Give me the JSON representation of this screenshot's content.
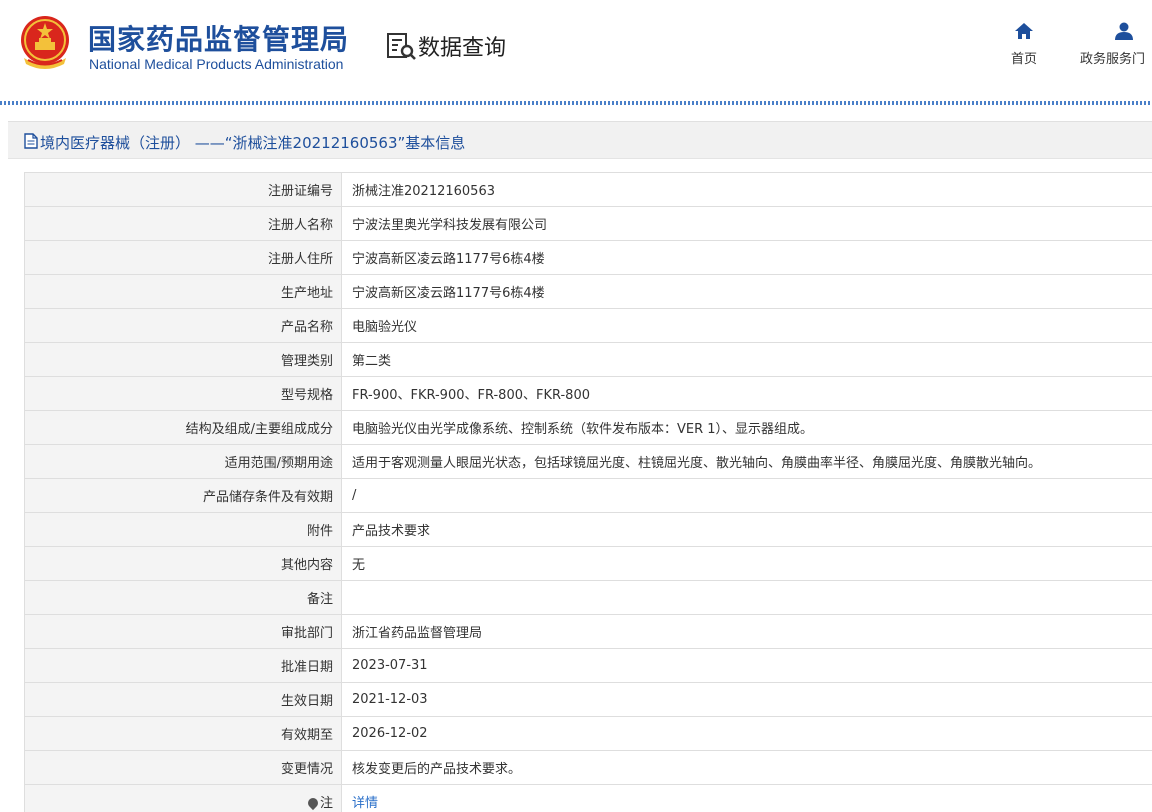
{
  "header": {
    "org_name_cn": "国家药品监督管理局",
    "org_name_en": "National Medical Products Administration",
    "section": "数据查询",
    "nav": [
      {
        "label": "首页",
        "icon": "home-icon"
      },
      {
        "label": "政务服务门",
        "icon": "user-icon"
      }
    ]
  },
  "title_bar": {
    "text": "境内医疗器械（注册） ——“浙械注准20212160563”基本信息",
    "icon": "document-icon"
  },
  "rows": [
    {
      "label": "注册证编号",
      "value": "浙械注准20212160563"
    },
    {
      "label": "注册人名称",
      "value": "宁波法里奥光学科技发展有限公司"
    },
    {
      "label": "注册人住所",
      "value": "宁波高新区凌云路1177号6栋4楼"
    },
    {
      "label": "生产地址",
      "value": "宁波高新区凌云路1177号6栋4楼"
    },
    {
      "label": "产品名称",
      "value": "电脑验光仪"
    },
    {
      "label": "管理类别",
      "value": "第二类"
    },
    {
      "label": "型号规格",
      "value": "FR-900、FKR-900、FR-800、FKR-800"
    },
    {
      "label": "结构及组成/主要组成成分",
      "value": "电脑验光仪由光学成像系统、控制系统（软件发布版本：VER 1）、显示器组成。"
    },
    {
      "label": "适用范围/预期用途",
      "value": "适用于客观测量人眼屈光状态，包括球镜屈光度、柱镜屈光度、散光轴向、角膜曲率半径、角膜屈光度、角膜散光轴向。"
    },
    {
      "label": "产品储存条件及有效期",
      "value": "/"
    },
    {
      "label": "附件",
      "value": "产品技术要求"
    },
    {
      "label": "其他内容",
      "value": "无"
    },
    {
      "label": "备注",
      "value": ""
    },
    {
      "label": "审批部门",
      "value": "浙江省药品监督管理局"
    },
    {
      "label": "批准日期",
      "value": "2023-07-31"
    },
    {
      "label": "生效日期",
      "value": "2021-12-03"
    },
    {
      "label": "有效期至",
      "value": "2026-12-02"
    },
    {
      "label": "变更情况",
      "value": "核发变更后的产品技术要求。"
    },
    {
      "label": "注",
      "value": "详情",
      "icon": "map-pin-icon"
    }
  ],
  "colors": {
    "brand_blue": "#1e4f9c",
    "link_blue": "#2a6fc9",
    "label_bg": "#f4f4f4"
  }
}
